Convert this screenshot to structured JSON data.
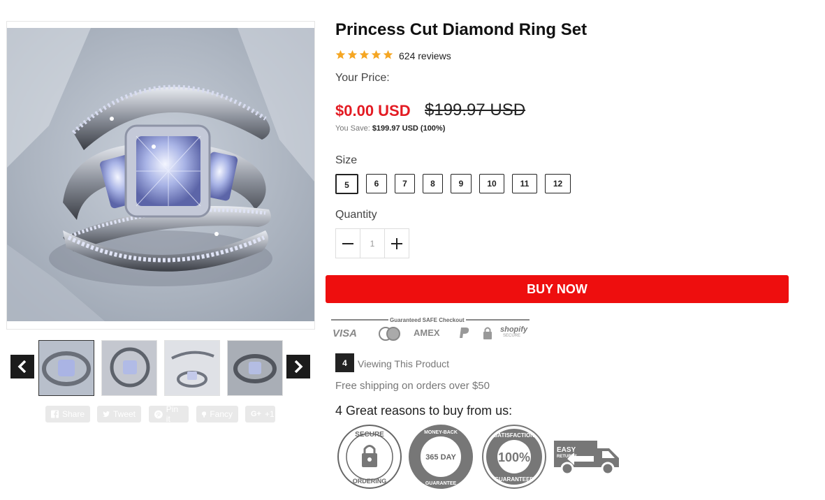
{
  "product": {
    "title": "Princess Cut Diamond Ring Set",
    "rating": 5,
    "reviews": "624 reviews",
    "price_label": "Your Price:",
    "price": "$0.00 USD",
    "compare_price": "$199.97 USD",
    "save_label": "You Save:",
    "save_value": "$199.97 USD (100%)"
  },
  "size": {
    "label": "Size",
    "options": [
      "5",
      "6",
      "7",
      "8",
      "9",
      "10",
      "11",
      "12"
    ],
    "selected": "5"
  },
  "quantity": {
    "label": "Quantity",
    "value": "1",
    "minus": "−",
    "plus": "+"
  },
  "buy_button": "BUY NOW",
  "checkout": {
    "title": "Guaranteed SAFE Checkout",
    "methods": [
      "VISA",
      "AMEX",
      "shopify"
    ],
    "shopify_sub": "SECURE"
  },
  "viewing": {
    "count": "4",
    "text": "Viewing This Product"
  },
  "shipping": "Free shipping on orders over $50",
  "reasons": {
    "title": "4 Great reasons to buy from us:",
    "secure_top": "SECURE",
    "secure_bottom": "ORDERING",
    "money_top": "MONEY-BACK",
    "money_center": "365 DAY",
    "money_bottom": "GUARANTEE",
    "sat_top": "SATISFACTION",
    "sat_center": "100%",
    "sat_bottom": "GUARANTEED",
    "easy_top": "EASY",
    "easy_bottom": "RETURNS"
  },
  "share": {
    "facebook": "Share",
    "twitter": "Tweet",
    "pinterest": "Pin it",
    "fancy": "Fancy",
    "google": "+1",
    "google_prefix": "G+"
  },
  "colors": {
    "accent": "#ee0e0e",
    "price": "#e31b23",
    "star": "#f5a623"
  },
  "icons": [
    "chevron-left-icon",
    "chevron-right-icon",
    "star-icon",
    "facebook-icon",
    "twitter-icon",
    "pinterest-icon",
    "fancy-icon",
    "lock-icon",
    "truck-icon"
  ]
}
